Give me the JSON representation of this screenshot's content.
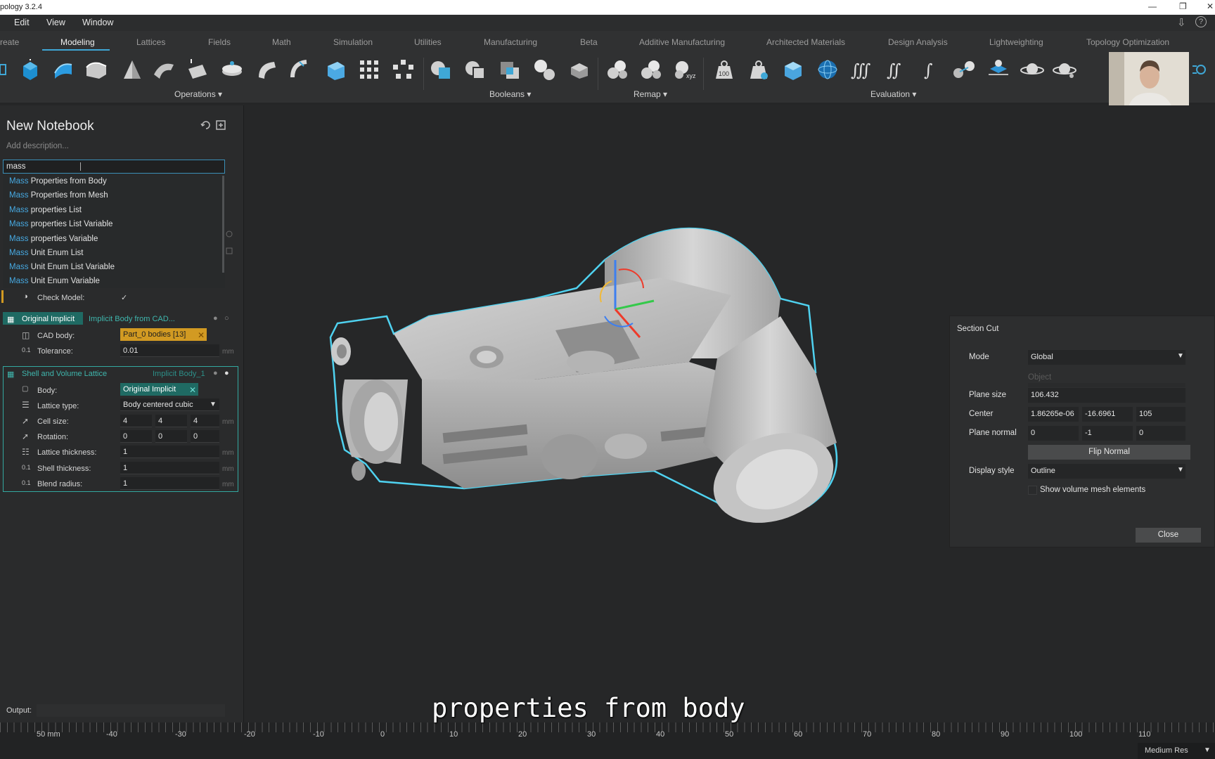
{
  "window": {
    "title": "pology 3.2.4"
  },
  "menu": [
    "Edit",
    "View",
    "Window"
  ],
  "ribbon_tabs": [
    "reate",
    "Modeling",
    "Lattices",
    "Fields",
    "Math",
    "Simulation",
    "Utilities",
    "Manufacturing",
    "Beta",
    "Additive Manufacturing",
    "Architected Materials",
    "Design Analysis",
    "Lightweighting",
    "Topology Optimization"
  ],
  "active_tab": "Modeling",
  "toolbar_groups": {
    "operations": "Operations",
    "booleans": "Booleans",
    "remap": "Remap",
    "evaluation": "Evaluation"
  },
  "toolbar_icon_badges": {
    "hundred": "100",
    "xyz": "xyz"
  },
  "notebook": {
    "title": "New Notebook",
    "description_placeholder": "Add description...",
    "search_value": "mass",
    "suggestion_highlight": "Mass",
    "suggestions": [
      "Properties from Body",
      "Properties from Mesh",
      "properties List",
      "properties List Variable",
      "properties Variable",
      "Unit Enum List",
      "Unit Enum List Variable",
      "Unit Enum Variable"
    ],
    "check_model": {
      "label": "Check Model:",
      "value": "✓"
    },
    "block1": {
      "name": "Original Implicit",
      "type": "Implicit Body from CAD...",
      "cad_body_label": "CAD body:",
      "cad_body_value": "Part_0 bodies [13]",
      "tolerance_label": "Tolerance:",
      "tolerance_value": "0.01",
      "unit": "mm"
    },
    "block2": {
      "name": "Shell and Volume Lattice",
      "type": "Implicit Body_1",
      "body_label": "Body:",
      "body_value": "Original Implicit",
      "lattice_type_label": "Lattice type:",
      "lattice_type_value": "Body centered cubic",
      "cell_size_label": "Cell size:",
      "cell_size": [
        "4",
        "4",
        "4"
      ],
      "rotation_label": "Rotation:",
      "rotation": [
        "0",
        "0",
        "0"
      ],
      "lattice_thickness_label": "Lattice thickness:",
      "lattice_thickness": "1",
      "shell_thickness_label": "Shell thickness:",
      "shell_thickness": "1",
      "blend_radius_label": "Blend radius:",
      "blend_radius": "1",
      "unit": "mm"
    },
    "output_label": "Output:"
  },
  "section_cut": {
    "title": "Section Cut",
    "mode_label": "Mode",
    "mode_value": "Global",
    "object_label": "Object",
    "plane_size_label": "Plane size",
    "plane_size": "106.432",
    "center_label": "Center",
    "center": [
      "1.86265e-06",
      "-16.6961",
      "105"
    ],
    "plane_normal_label": "Plane normal",
    "plane_normal": [
      "0",
      "-1",
      "0"
    ],
    "flip_normal": "Flip Normal",
    "display_style_label": "Display style",
    "display_style_value": "Outline",
    "show_volume_mesh": "Show volume mesh elements",
    "close": "Close"
  },
  "ruler": {
    "labels": [
      "50 mm",
      "-40",
      "-30",
      "-20",
      "-10",
      "0",
      "10",
      "20",
      "30",
      "40",
      "50",
      "60",
      "70",
      "80",
      "90",
      "100",
      "110"
    ]
  },
  "resolution": "Medium Res",
  "subtitle": "properties from body",
  "colors": {
    "accent": "#3fa7d6",
    "teal": "#33a8a0",
    "search_highlight": "#46a8e0",
    "cad_chip": "#d29a22"
  }
}
